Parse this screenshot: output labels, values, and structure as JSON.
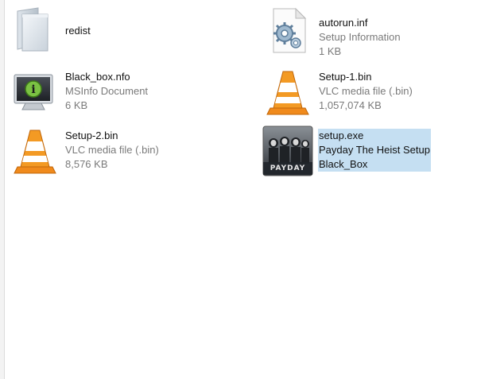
{
  "files": [
    {
      "name": "redist",
      "type": "",
      "size": "",
      "icon": "folder-icon"
    },
    {
      "name": "autorun.inf",
      "type": "Setup Information",
      "size": "1 KB",
      "icon": "gear-file-icon"
    },
    {
      "name": "Black_box.nfo",
      "type": "MSInfo Document",
      "size": "6 KB",
      "icon": "info-monitor-icon"
    },
    {
      "name": "Setup-1.bin",
      "type": "VLC media file (.bin)",
      "size": "1,057,074 KB",
      "icon": "vlc-cone-icon"
    },
    {
      "name": "Setup-2.bin",
      "type": "VLC media file (.bin)",
      "size": "8,576 KB",
      "icon": "vlc-cone-icon"
    },
    {
      "name": "setup.exe",
      "type": "Payday The Heist Setup",
      "size": "Black_Box",
      "icon": "payday-app-icon",
      "logo_text": "PAYDAY",
      "selected": true
    }
  ]
}
